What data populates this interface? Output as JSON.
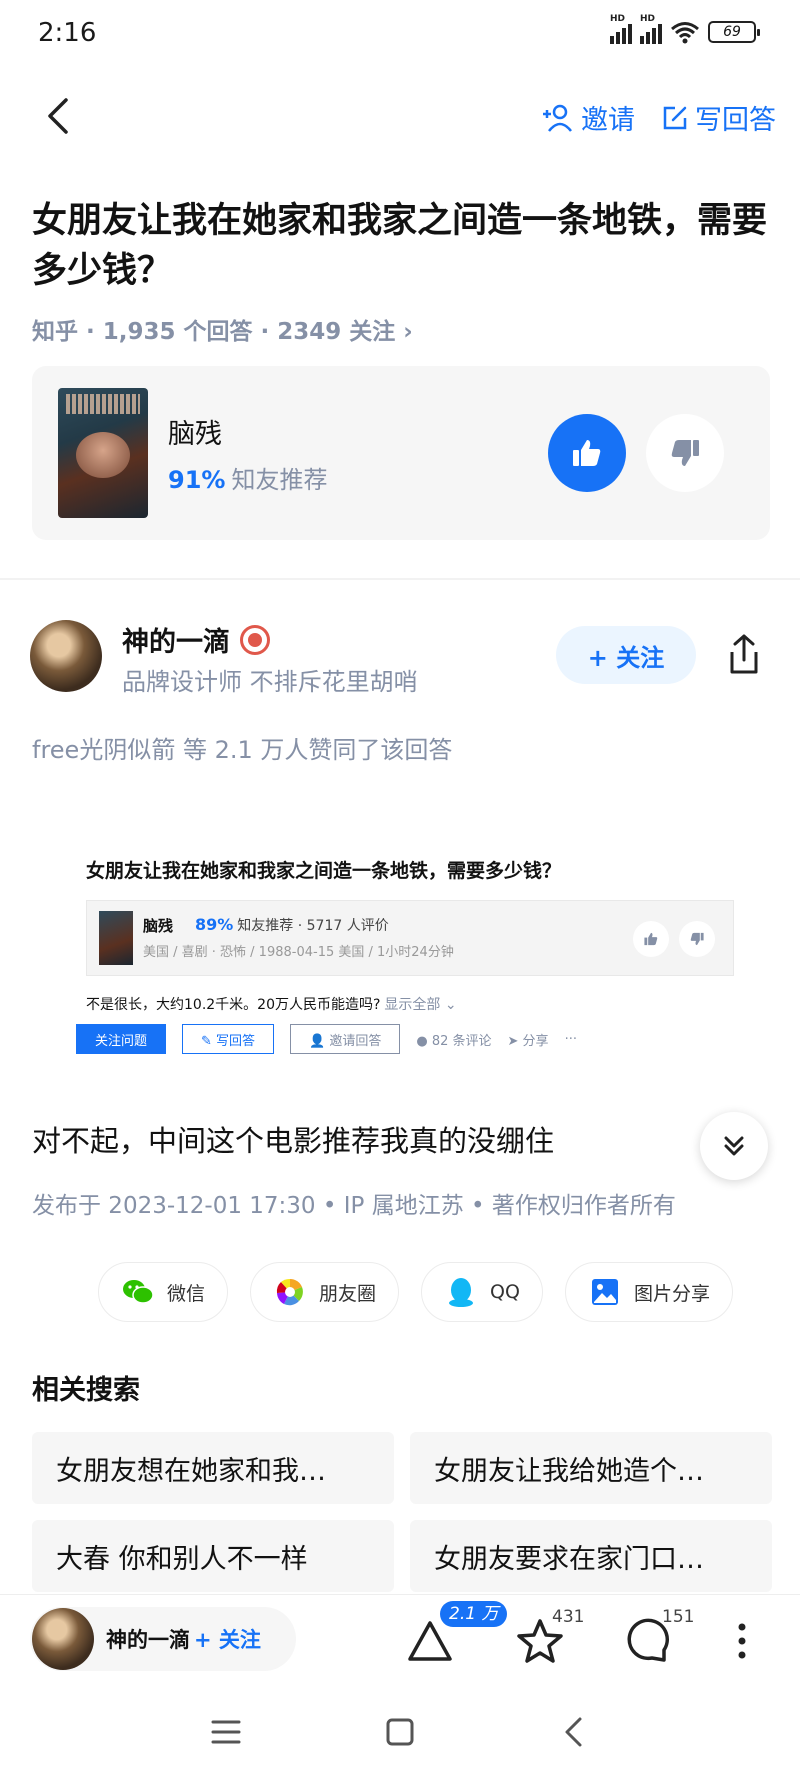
{
  "status": {
    "time": "2:16",
    "battery": "69",
    "network": "HD"
  },
  "topbar": {
    "invite_label": "邀请",
    "write_answer_label": "写回答"
  },
  "question": {
    "title": "女朋友让我在她家和我家之间造一条地铁，需要多少钱？",
    "meta": "知乎 · 1,935 个回答 · 2349 关注 ›"
  },
  "movie": {
    "name": "脑残",
    "percent": "91%",
    "recommend_text": "知友推荐"
  },
  "author": {
    "name": "神的一滴",
    "bio": "品牌设计师 不排斥花里胡哨",
    "follow_label": "+ 关注"
  },
  "upvoters": "free光阴似箭 等 2.1 万人赞同了该回答",
  "embed": {
    "title": "女朋友让我在她家和我家之间造一条地铁，需要多少钱？",
    "movie_name": "脑残",
    "percent": "89%",
    "rating_text": "知友推荐 · 5717 人评价",
    "info": "美国 / 喜剧 · 恐怖 / 1988-04-15 美国 / 1小时24分钟",
    "desc": "不是很长，大约10.2千米。20万人民币能造吗?",
    "show_all": "显示全部 ⌄",
    "follow_question": "关注问题",
    "write_answer": "✎ 写回答",
    "invite_answer": "👤 邀请回答",
    "comments": "● 82 条评论",
    "share": "➤ 分享",
    "more": "···"
  },
  "answer": {
    "text": "对不起，中间这个电影推荐我真的没绷住",
    "publish_info": "发布于 2023-12-01 17:30 • IP 属地江苏 • 著作权归作者所有"
  },
  "share_options": [
    {
      "label": "微信",
      "icon": "wechat-icon"
    },
    {
      "label": "朋友圈",
      "icon": "moments-icon"
    },
    {
      "label": "QQ",
      "icon": "qq-icon"
    },
    {
      "label": "图片分享",
      "icon": "image-share-icon"
    }
  ],
  "related": {
    "title": "相关搜索",
    "items": [
      "女朋友想在她家和我…",
      "女朋友让我给她造个…",
      "大春 你和别人不一样",
      "女朋友要求在家门口…"
    ]
  },
  "bottom_bar": {
    "author_name": "神的一滴",
    "follow_label": "+ 关注",
    "upvote_count": "2.1 万",
    "favorite_count": "431",
    "comment_count": "151"
  },
  "colors": {
    "accent": "#1772f6",
    "gray_text": "#8590a6",
    "card_bg": "#f6f6f6"
  }
}
